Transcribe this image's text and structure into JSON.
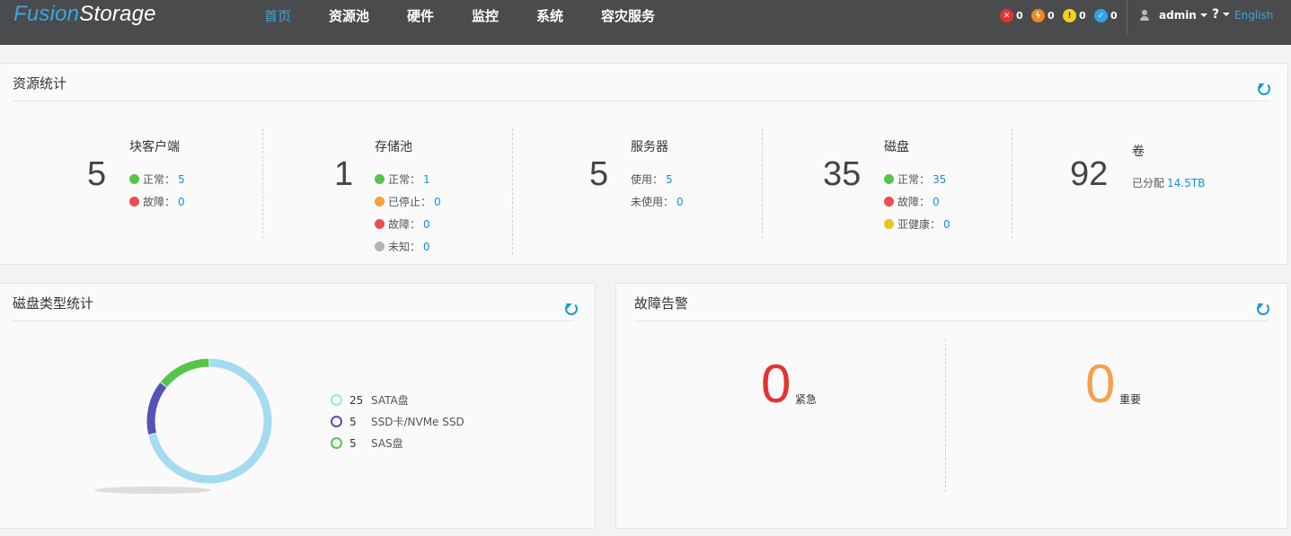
{
  "header": {
    "logo_part1": "Fusion",
    "logo_part2": "Storage",
    "nav": [
      "首页",
      "资源池",
      "硬件",
      "监控",
      "系统",
      "容灾服务"
    ],
    "alarms": [
      {
        "icon": "critical-alarm-icon",
        "count": "0",
        "color": "#e63131",
        "glyph": "✕"
      },
      {
        "icon": "major-alarm-icon",
        "count": "0",
        "color": "#f08a1c",
        "glyph": "ϟ"
      },
      {
        "icon": "minor-alarm-icon",
        "count": "0",
        "color": "#f3d21c",
        "glyph": "!"
      },
      {
        "icon": "info-alarm-icon",
        "count": "0",
        "color": "#2aa7e3",
        "glyph": "✓"
      }
    ],
    "user": "admin",
    "help": "?",
    "language": "English"
  },
  "resource_stats": {
    "title": "资源统计",
    "block_clients": {
      "count": "5",
      "label": "块客户端",
      "normal_label": "正常：",
      "normal": "5",
      "fault_label": "故障：",
      "fault": "0"
    },
    "storage_pools": {
      "count": "1",
      "label": "存储池",
      "normal_label": "正常：",
      "normal": "1",
      "stopped_label": "已停止：",
      "stopped": "0",
      "fault_label": "故障：",
      "fault": "0",
      "unknown_label": "未知：",
      "unknown": "0"
    },
    "servers": {
      "count": "5",
      "label": "服务器",
      "used_label": "使用：",
      "used": "5",
      "unused_label": "未使用：",
      "unused": "0"
    },
    "disks": {
      "count": "35",
      "label": "磁盘",
      "normal_label": "正常：",
      "normal": "35",
      "fault_label": "故障：",
      "fault": "0",
      "subhealth_label": "亚健康：",
      "subhealth": "0"
    },
    "volumes": {
      "count": "92",
      "label": "卷",
      "allocated_label": "已分配",
      "allocated": "14.5TB"
    }
  },
  "disk_types": {
    "title": "磁盘类型统计",
    "items": [
      {
        "count": "25",
        "label": "SATA盘",
        "color": "#a3dbf1"
      },
      {
        "count": "5",
        "label": "SSD卡/NVMe SSD",
        "color": "#5553b6"
      },
      {
        "count": "5",
        "label": "SAS盘",
        "color": "#55c649"
      }
    ]
  },
  "fault_alarms": {
    "title": "故障告警",
    "urgent": {
      "count": "0",
      "label": "紧急",
      "color": "#e63131"
    },
    "important": {
      "count": "0",
      "label": "重要",
      "color": "#f5a04a"
    }
  },
  "colors": {
    "accent": "#3ca6e0",
    "header_bg": "#4a4b4d",
    "normal": "#55c649",
    "fault": "#ec4e4e",
    "stopped": "#f5a03a",
    "unknown": "#b5b5b5",
    "subhealth": "#e8c71b"
  }
}
